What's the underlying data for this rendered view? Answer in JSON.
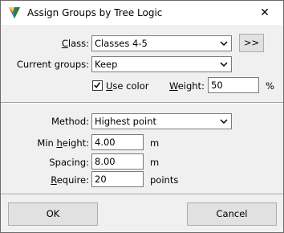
{
  "window": {
    "title": "Assign Groups by Tree Logic",
    "close": "✕"
  },
  "class": {
    "label_u": "C",
    "label_rest": "lass:",
    "value": "Classes 4-5",
    "more_button": ">>"
  },
  "current_groups": {
    "label": "Current groups:",
    "value": "Keep"
  },
  "use_color": {
    "checked": true,
    "label_u": "U",
    "label_rest": "se color"
  },
  "weight": {
    "label_u": "W",
    "label_rest": "eight:",
    "value": "50",
    "unit": "%"
  },
  "method": {
    "label": "Method:",
    "value": "Highest point"
  },
  "min_height": {
    "label_pre": "Min ",
    "label_u": "h",
    "label_rest": "eight:",
    "value": "4.00",
    "unit": "m"
  },
  "spacing": {
    "label": "Spacing:",
    "value": "8.00",
    "unit": "m"
  },
  "require": {
    "label_u": "R",
    "label_rest": "equire:",
    "value": "20",
    "unit": "points"
  },
  "buttons": {
    "ok": "OK",
    "cancel": "Cancel"
  },
  "colors": {
    "window_bg": "#f0f0f0",
    "button_bg": "#e1e1e1",
    "border": "#7a7a7a"
  }
}
